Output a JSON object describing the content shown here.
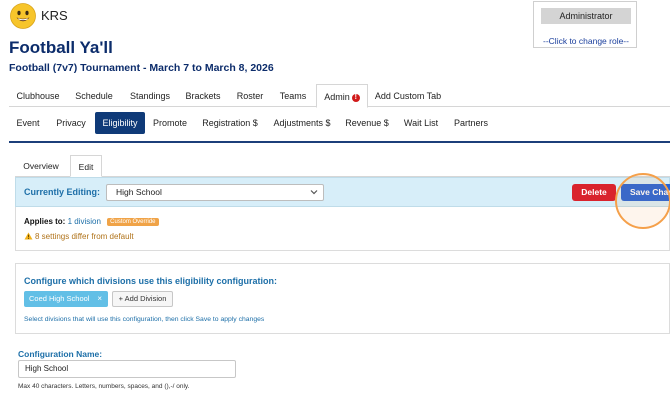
{
  "app": {
    "name": "KRS"
  },
  "role": {
    "current": "Administrator",
    "change_link": "--Click to change role--"
  },
  "event": {
    "title": "Football Ya'll",
    "subtitle": "Football (7v7) Tournament  -  March 7 to March 8, 2026"
  },
  "main_tabs": [
    {
      "label": "Clubhouse"
    },
    {
      "label": "Schedule"
    },
    {
      "label": "Standings"
    },
    {
      "label": "Brackets"
    },
    {
      "label": "Roster"
    },
    {
      "label": "Teams"
    },
    {
      "label": "Admin",
      "active": true,
      "alert": "!"
    },
    {
      "label": "Add Custom Tab"
    }
  ],
  "admin_tabs": [
    {
      "label": "Event"
    },
    {
      "label": "Privacy"
    },
    {
      "label": "Eligibility",
      "active": true
    },
    {
      "label": "Promote"
    },
    {
      "label": "Registration $"
    },
    {
      "label": "Adjustments $"
    },
    {
      "label": "Revenue $"
    },
    {
      "label": "Wait List"
    },
    {
      "label": "Partners"
    }
  ],
  "sub_tabs": [
    {
      "label": "Overview"
    },
    {
      "label": "Edit",
      "active": true
    }
  ],
  "editing": {
    "label": "Currently Editing:",
    "selected": "High School",
    "delete_label": "Delete",
    "save_label": "Save Changes"
  },
  "applies": {
    "label": "Applies to:",
    "link": "1 division",
    "badge": "Custom Override",
    "warning": "8 settings differ from default"
  },
  "divisions": {
    "heading": "Configure which divisions use this eligibility configuration:",
    "selected": [
      {
        "label": "Coed High School",
        "remove": "×"
      }
    ],
    "add_label": "+ Add Division",
    "help": "Select divisions that will use this configuration, then click Save to apply changes"
  },
  "config_name": {
    "label": "Configuration Name:",
    "value": "High School",
    "hint": "Max 40 characters. Letters, numbers, spaces, and (),-/ only."
  },
  "colors": {
    "navy": "#0c2c6b",
    "active_tab": "#0f3a78",
    "accent_blue": "#1d6fa8",
    "editing_bar": "#d7eef9",
    "delete": "#d9232d",
    "save": "#2563d6",
    "chip": "#62bfe6",
    "warning": "#b0731a",
    "badge": "#f0a347"
  },
  "icons": {
    "logo": "smiley-face-icon",
    "alert": "exclamation-circle-icon",
    "select": "chevron-down-icon",
    "warning": "warning-triangle-icon",
    "remove": "close-icon"
  }
}
